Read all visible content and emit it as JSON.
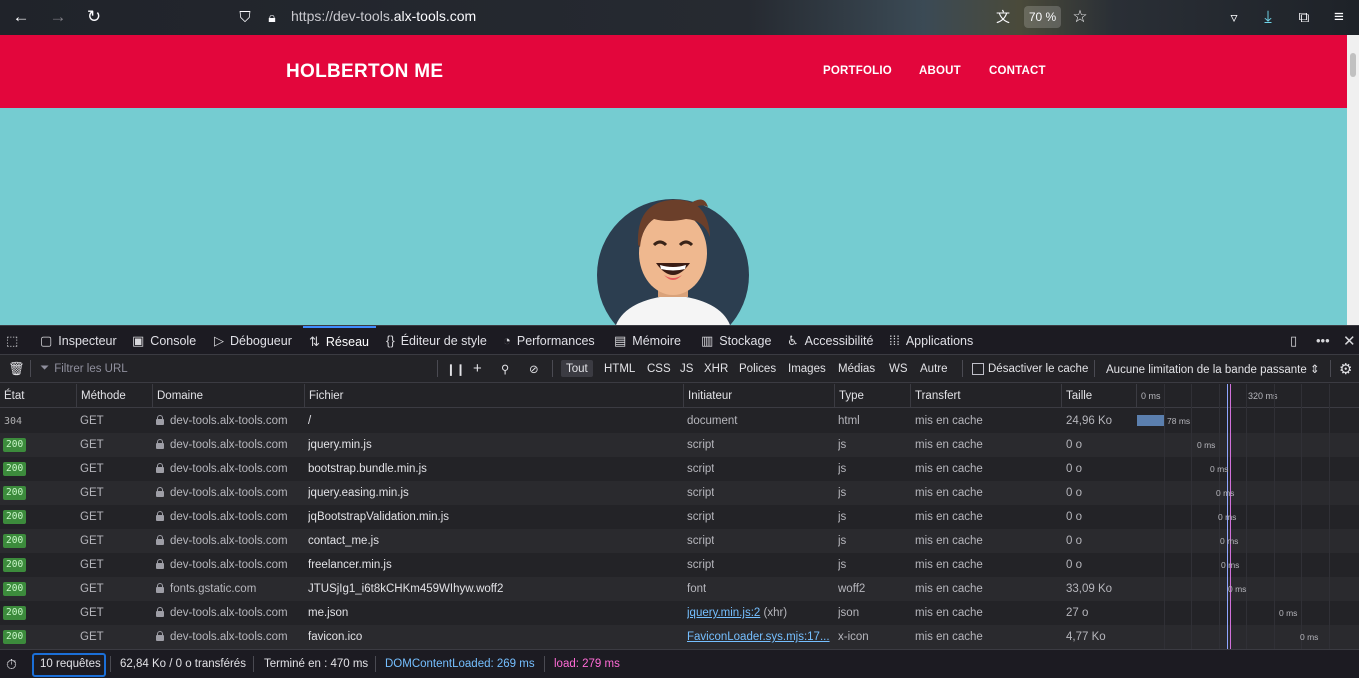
{
  "browser": {
    "url_prefix": "https://dev-tools.",
    "url_domain": "alx-tools.com",
    "zoom": "70 %"
  },
  "site": {
    "brand": "HOLBERTON ME",
    "nav": [
      "PORTFOLIO",
      "ABOUT",
      "CONTACT"
    ]
  },
  "devtools": {
    "tabs": [
      {
        "label": "Inspecteur"
      },
      {
        "label": "Console"
      },
      {
        "label": "Débogueur"
      },
      {
        "label": "Réseau"
      },
      {
        "label": "Éditeur de style"
      },
      {
        "label": "Performances"
      },
      {
        "label": "Mémoire"
      },
      {
        "label": "Stockage"
      },
      {
        "label": "Accessibilité"
      },
      {
        "label": "Applications"
      }
    ],
    "active_tab": "Réseau",
    "filter_placeholder": "Filtrer les URL",
    "filters": [
      "Tout",
      "HTML",
      "CSS",
      "JS",
      "XHR",
      "Polices",
      "Images",
      "Médias",
      "WS",
      "Autre"
    ],
    "disable_cache": "Désactiver le cache",
    "throttling": "Aucune limitation de la bande passante ⇕",
    "columns": [
      "État",
      "Méthode",
      "Domaine",
      "Fichier",
      "Initiateur",
      "Type",
      "Transfert",
      "Taille"
    ],
    "timeline_ticks": [
      "0 ms",
      "320 ms"
    ],
    "rows": [
      {
        "status": "304",
        "method": "GET",
        "domain": "dev-tools.alx-tools.com",
        "file": "/",
        "initiator": "document",
        "type": "html",
        "transfer": "mis en cache",
        "size": "24,96 Ko",
        "timing": "78 ms"
      },
      {
        "status": "200",
        "method": "GET",
        "domain": "dev-tools.alx-tools.com",
        "file": "jquery.min.js",
        "initiator": "script",
        "type": "js",
        "transfer": "mis en cache",
        "size": "0 o",
        "timing": "0 ms"
      },
      {
        "status": "200",
        "method": "GET",
        "domain": "dev-tools.alx-tools.com",
        "file": "bootstrap.bundle.min.js",
        "initiator": "script",
        "type": "js",
        "transfer": "mis en cache",
        "size": "0 o",
        "timing": "0 ms"
      },
      {
        "status": "200",
        "method": "GET",
        "domain": "dev-tools.alx-tools.com",
        "file": "jquery.easing.min.js",
        "initiator": "script",
        "type": "js",
        "transfer": "mis en cache",
        "size": "0 o",
        "timing": "0 ms"
      },
      {
        "status": "200",
        "method": "GET",
        "domain": "dev-tools.alx-tools.com",
        "file": "jqBootstrapValidation.min.js",
        "initiator": "script",
        "type": "js",
        "transfer": "mis en cache",
        "size": "0 o",
        "timing": "0 ms"
      },
      {
        "status": "200",
        "method": "GET",
        "domain": "dev-tools.alx-tools.com",
        "file": "contact_me.js",
        "initiator": "script",
        "type": "js",
        "transfer": "mis en cache",
        "size": "0 o",
        "timing": "0 ms"
      },
      {
        "status": "200",
        "method": "GET",
        "domain": "dev-tools.alx-tools.com",
        "file": "freelancer.min.js",
        "initiator": "script",
        "type": "js",
        "transfer": "mis en cache",
        "size": "0 o",
        "timing": "0 ms"
      },
      {
        "status": "200",
        "method": "GET",
        "domain": "fonts.gstatic.com",
        "file": "JTUSjIg1_i6t8kCHKm459WIhyw.woff2",
        "initiator": "font",
        "type": "woff2",
        "transfer": "mis en cache",
        "size": "33,09 Ko",
        "timing": "0 ms"
      },
      {
        "status": "200",
        "method": "GET",
        "domain": "dev-tools.alx-tools.com",
        "file": "me.json",
        "initiator": "jquery.min.js:2",
        "initiator_suffix": " (xhr)",
        "type": "json",
        "transfer": "mis en cache",
        "size": "27 o",
        "timing": "0 ms"
      },
      {
        "status": "200",
        "method": "GET",
        "domain": "dev-tools.alx-tools.com",
        "file": "favicon.ico",
        "initiator": "FaviconLoader.sys.mjs:17...",
        "type": "x-icon",
        "transfer": "mis en cache",
        "size": "4,77 Ko",
        "timing": "0 ms"
      }
    ],
    "status_bar": {
      "requests": "10 requêtes",
      "transferred": "62,84 Ko / 0 o transférés",
      "finished": "Terminé en : 470 ms",
      "dom_loaded": "DOMContentLoaded: 269 ms",
      "load": "load: 279 ms"
    }
  }
}
